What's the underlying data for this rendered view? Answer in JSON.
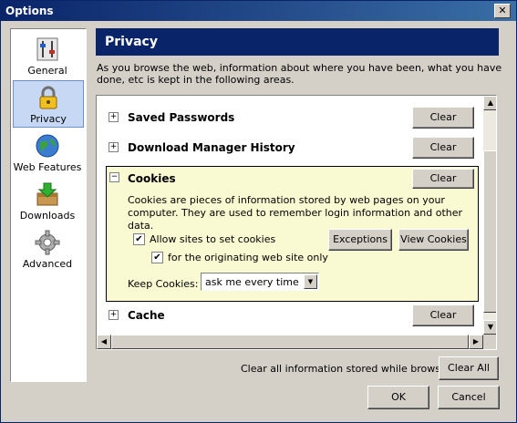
{
  "window": {
    "title": "Options",
    "close_glyph": "✕"
  },
  "sidebar": {
    "items": [
      {
        "label": "General",
        "icon": "sliders-icon"
      },
      {
        "label": "Privacy",
        "icon": "padlock-icon",
        "selected": true
      },
      {
        "label": "Web Features",
        "icon": "globe-icon"
      },
      {
        "label": "Downloads",
        "icon": "download-box-icon"
      },
      {
        "label": "Advanced",
        "icon": "gear-icon"
      }
    ]
  },
  "panel": {
    "title": "Privacy",
    "description": "As you browse the web, information about where you have been, what you have done, etc is kept in the following areas."
  },
  "sections": {
    "saved_passwords": {
      "label": "Saved Passwords",
      "clear": "Clear",
      "toggle": "+"
    },
    "download_history": {
      "label": "Download Manager History",
      "clear": "Clear",
      "toggle": "+"
    },
    "cookies": {
      "label": "Cookies",
      "clear": "Clear",
      "toggle": "−",
      "description": "Cookies are pieces of information stored by web pages on your computer. They are used to remember login information and other data.",
      "allow_label": "Allow sites to set cookies",
      "allow_checked": true,
      "originating_label": "for the originating web site only",
      "originating_checked": true,
      "check_glyph": "✔",
      "exceptions": "Exceptions",
      "view_cookies": "View Cookies",
      "keep_label": "Keep Cookies:",
      "keep_value": "ask me every time",
      "dropdown_glyph": "▼"
    },
    "cache": {
      "label": "Cache",
      "clear": "Clear",
      "toggle": "+"
    }
  },
  "scroll": {
    "up": "▲",
    "down": "▼",
    "left": "◀",
    "right": "▶"
  },
  "footer": {
    "clear_all_label": "Clear all information stored while browsing:",
    "clear_all": "Clear All",
    "ok": "OK",
    "cancel": "Cancel"
  }
}
